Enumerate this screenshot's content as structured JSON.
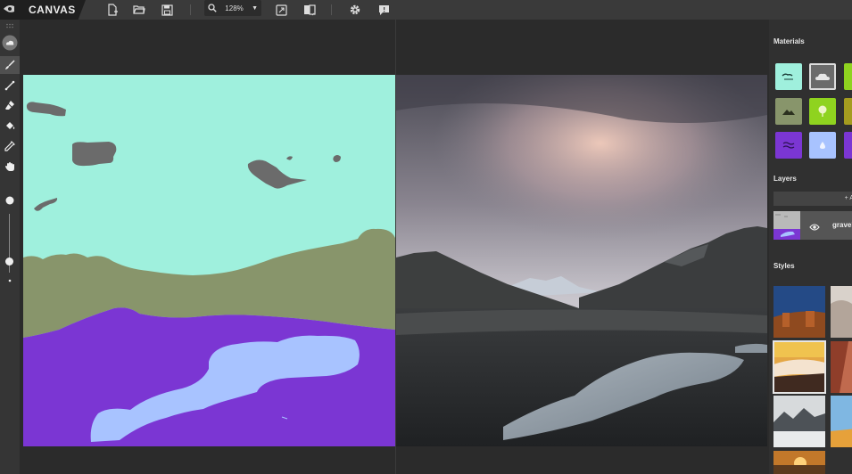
{
  "app": {
    "logo_text": "NVIDIA",
    "brand": "CANVAS"
  },
  "toolbar": {
    "icons": [
      "new-file-icon",
      "open-folder-icon",
      "save-icon",
      "search-icon",
      "fit-screen-icon",
      "compare-view-icon",
      "gear-icon",
      "feedback-icon"
    ],
    "zoom_value": "128%",
    "zoom_arrow": "▼"
  },
  "left_tools": {
    "icons": [
      "cloud-material-icon",
      "brush-icon",
      "line-icon",
      "eraser-icon",
      "fill-bucket-icon",
      "eyedropper-icon",
      "hand-pan-icon"
    ],
    "active": "brush-icon",
    "brush_size_level": 0.62
  },
  "materials": {
    "title": "Materials",
    "colors": {
      "sky": "#9ff0dd",
      "cloud": "#6b6b6b",
      "grass": "#88956b",
      "hill": "#88956b",
      "water": "#7b36d3",
      "snow": "#a8c3ff",
      "lime": "#8fd31f"
    },
    "selected": "cloud"
  },
  "layers": {
    "title": "Layers",
    "add_label": "+ A",
    "layer_name": "gravel"
  },
  "styles": {
    "title": "Styles"
  }
}
